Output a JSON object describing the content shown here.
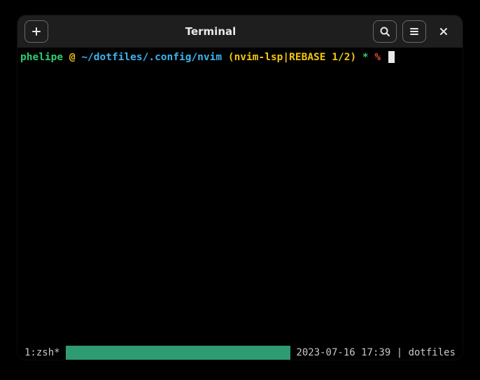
{
  "window": {
    "title": "Terminal"
  },
  "prompt": {
    "user": "phelipe",
    "at": "@",
    "path": "~/dotfiles/.config/nvim",
    "branch": "(nvim-lsp|REBASE 1/2)",
    "dirty": "*",
    "sigil": "%"
  },
  "status": {
    "left": "1:zsh*",
    "datetime": "2023-07-16 17:39",
    "sep": " | ",
    "session": "dotfiles"
  }
}
